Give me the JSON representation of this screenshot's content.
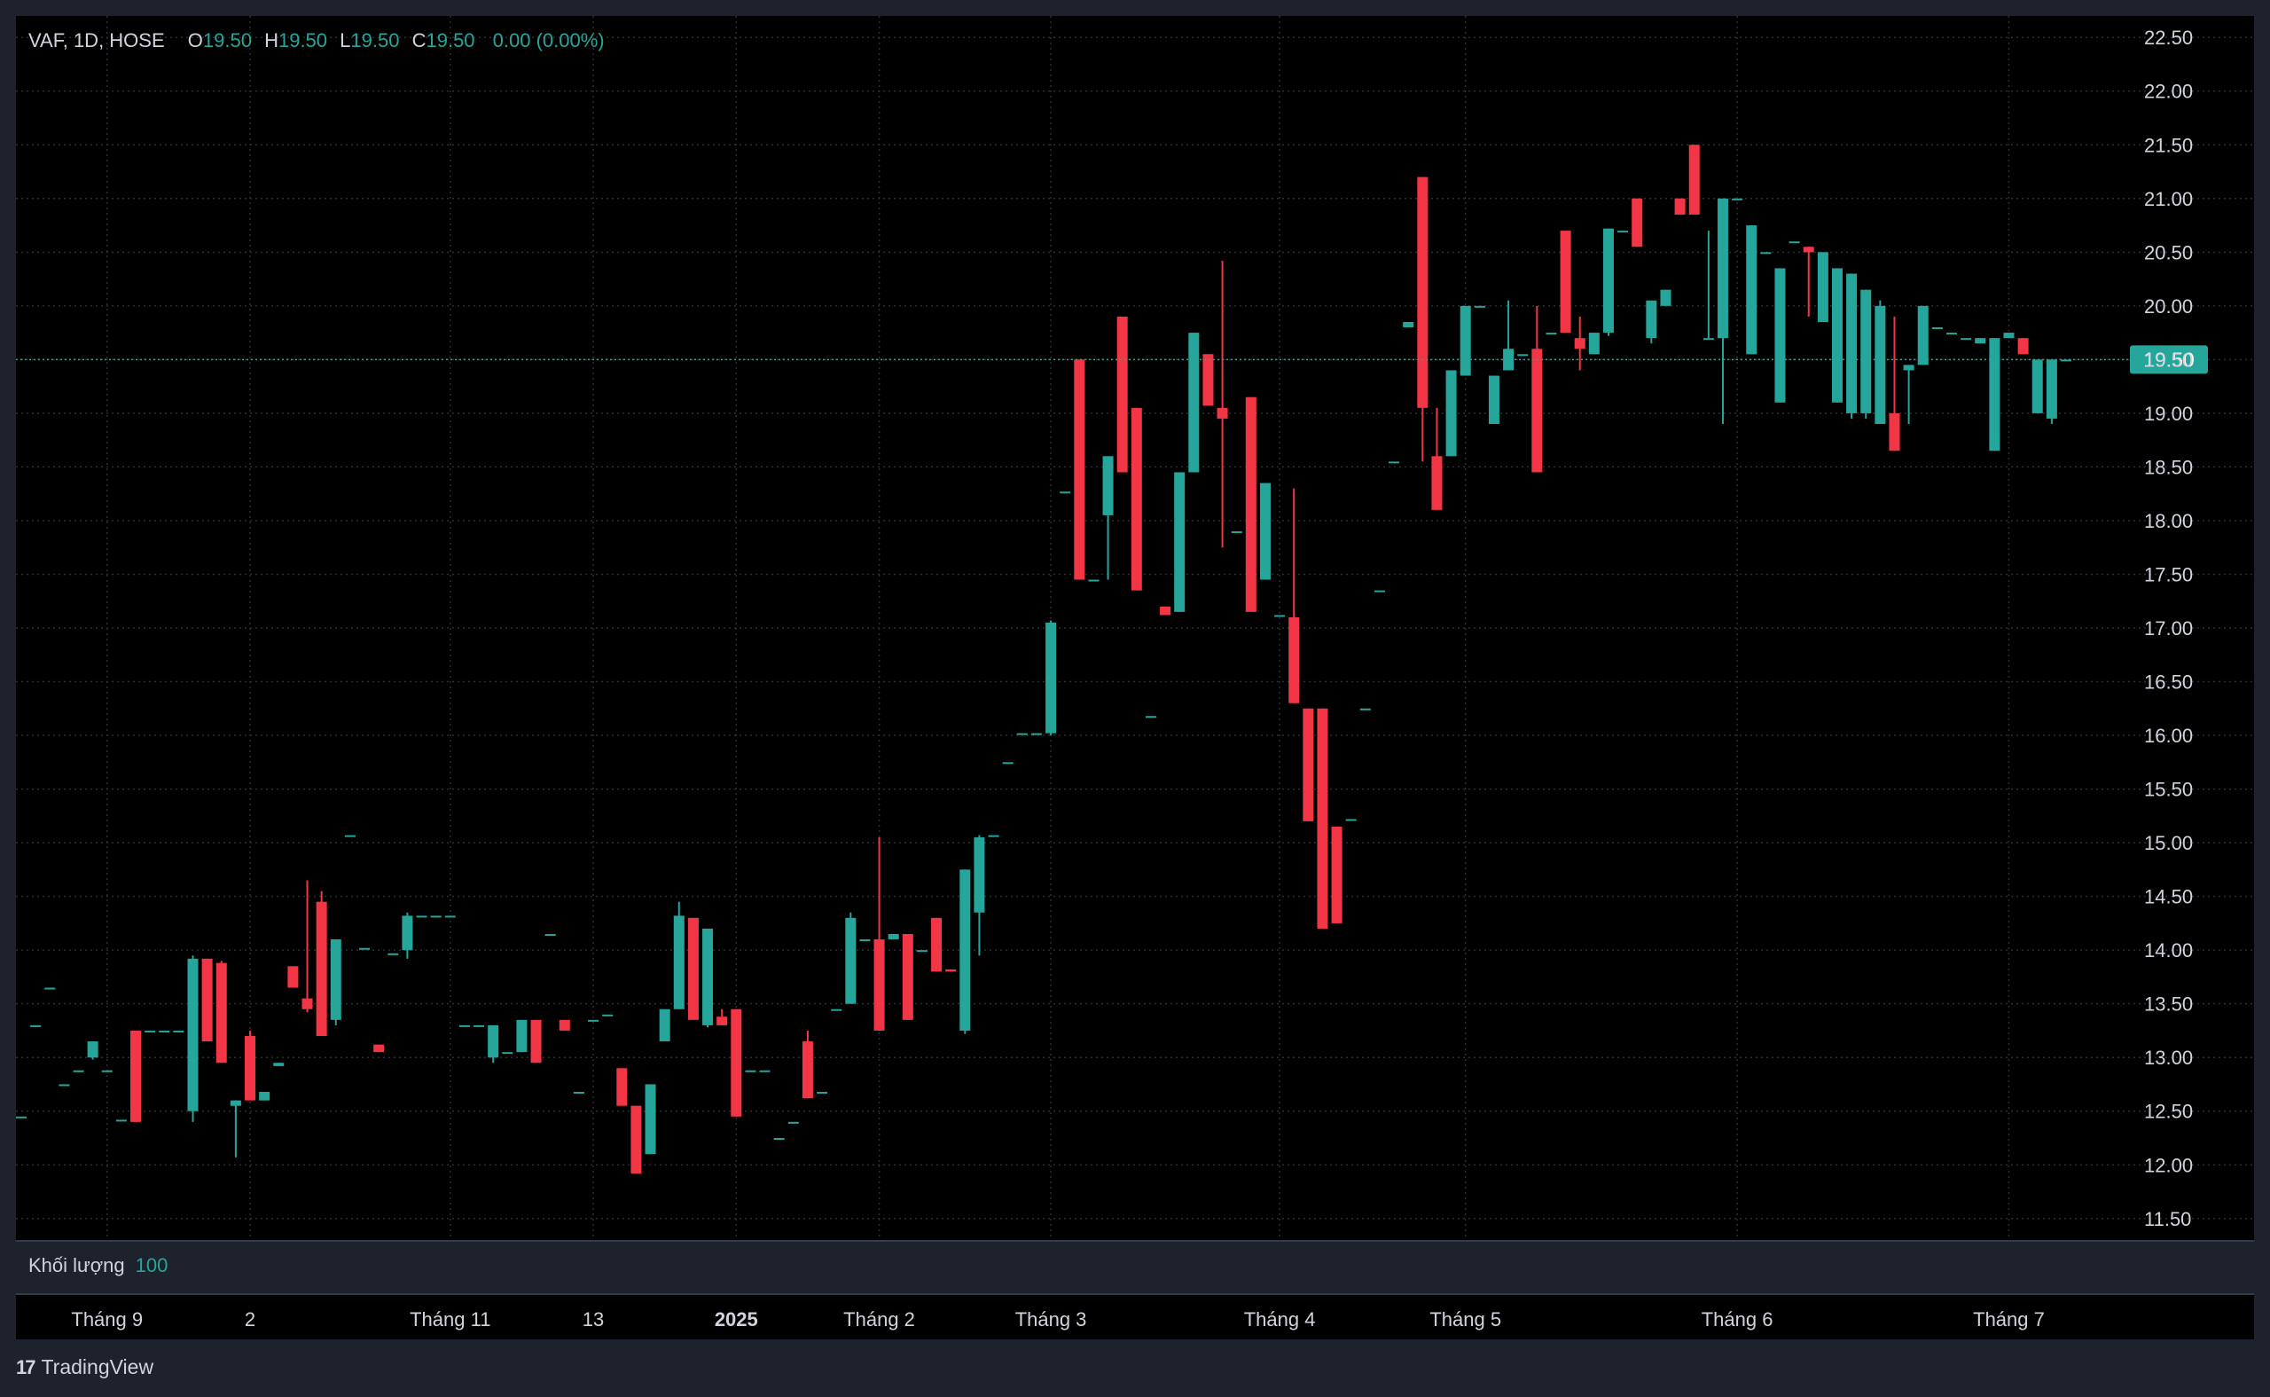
{
  "legend": {
    "symbol": "VAF, 1D, HOSE",
    "open_label": "O",
    "open": "19.50",
    "high_label": "H",
    "high": "19.50",
    "low_label": "L",
    "low": "19.50",
    "close_label": "C",
    "close": "19.50",
    "change": "0.00 (0.00%)"
  },
  "volume": {
    "label": "Khối lượng",
    "value": "100"
  },
  "brand": {
    "logo_icon": "tradingview-logo-icon",
    "name": "TradingView"
  },
  "colors": {
    "up": "#26a69a",
    "down": "#f23645",
    "background": "#000000",
    "frame": "#1e222d",
    "grid": "#2a2e39",
    "text": "#d1d4dc"
  },
  "chart_data": {
    "type": "candlestick",
    "grid": true,
    "y_axis_position": "right",
    "ylim": [
      11.3,
      22.7
    ],
    "y_ticks": [
      "22.50",
      "22.00",
      "21.50",
      "21.00",
      "20.50",
      "20.00",
      "19.50",
      "19.00",
      "18.50",
      "18.00",
      "17.50",
      "17.00",
      "16.50",
      "16.00",
      "15.50",
      "15.00",
      "14.50",
      "14.00",
      "13.50",
      "13.00",
      "12.50",
      "12.00",
      "11.50"
    ],
    "last_price_label": "19.50",
    "x_ticks": [
      {
        "label": "Tháng 9",
        "i": 6,
        "bold": false
      },
      {
        "label": "2",
        "i": 16,
        "bold": false
      },
      {
        "label": "Tháng 11",
        "i": 30,
        "bold": false
      },
      {
        "label": "13",
        "i": 40,
        "bold": false
      },
      {
        "label": "2025",
        "i": 50,
        "bold": true
      },
      {
        "label": "Tháng 2",
        "i": 60,
        "bold": false
      },
      {
        "label": "Tháng 3",
        "i": 72,
        "bold": false
      },
      {
        "label": "Tháng 4",
        "i": 88,
        "bold": false
      },
      {
        "label": "Tháng 5",
        "i": 101,
        "bold": false
      },
      {
        "label": "Tháng 6",
        "i": 120,
        "bold": false
      },
      {
        "label": "Tháng 7",
        "i": 139,
        "bold": false
      }
    ],
    "candles": [
      [
        12.45,
        12.45,
        12.45,
        12.45
      ],
      [
        13.3,
        13.3,
        13.3,
        13.3
      ],
      [
        13.65,
        13.65,
        13.65,
        13.65
      ],
      [
        12.75,
        12.75,
        12.75,
        12.75
      ],
      [
        12.88,
        12.88,
        12.88,
        12.88
      ],
      [
        13.0,
        13.15,
        12.98,
        13.15
      ],
      [
        12.88,
        12.88,
        12.88,
        12.88
      ],
      [
        12.42,
        12.42,
        12.42,
        12.42
      ],
      [
        13.25,
        13.25,
        12.4,
        12.4
      ],
      [
        13.25,
        13.25,
        13.25,
        13.25
      ],
      [
        13.25,
        13.25,
        13.25,
        13.25
      ],
      [
        13.25,
        13.25,
        13.25,
        13.25
      ],
      [
        12.5,
        13.95,
        12.4,
        13.92
      ],
      [
        13.92,
        13.92,
        13.15,
        13.15
      ],
      [
        13.88,
        13.9,
        12.95,
        12.95
      ],
      [
        12.55,
        12.6,
        12.07,
        12.6
      ],
      [
        13.2,
        13.25,
        12.6,
        12.6
      ],
      [
        12.6,
        12.68,
        12.6,
        12.68
      ],
      [
        12.92,
        12.95,
        12.92,
        12.95
      ],
      [
        13.85,
        13.85,
        13.65,
        13.65
      ],
      [
        13.55,
        14.65,
        13.42,
        13.45
      ],
      [
        14.45,
        14.55,
        13.2,
        13.2
      ],
      [
        13.35,
        14.1,
        13.3,
        14.1
      ],
      [
        15.07,
        15.07,
        15.07,
        15.07
      ],
      [
        14.02,
        14.02,
        14.02,
        14.02
      ],
      [
        13.12,
        13.12,
        13.05,
        13.05
      ],
      [
        13.97,
        13.97,
        13.97,
        13.97
      ],
      [
        14.0,
        14.35,
        13.92,
        14.32
      ],
      [
        14.32,
        14.32,
        14.32,
        14.32
      ],
      [
        14.32,
        14.32,
        14.32,
        14.32
      ],
      [
        14.32,
        14.32,
        14.32,
        14.32
      ],
      [
        13.3,
        13.3,
        13.3,
        13.3
      ],
      [
        13.3,
        13.3,
        13.3,
        13.3
      ],
      [
        13.0,
        13.3,
        12.95,
        13.3
      ],
      [
        13.05,
        13.05,
        13.05,
        13.05
      ],
      [
        13.05,
        13.35,
        13.05,
        13.35
      ],
      [
        13.35,
        13.35,
        12.95,
        12.95
      ],
      [
        14.15,
        14.15,
        14.15,
        14.15
      ],
      [
        13.35,
        13.35,
        13.25,
        13.25
      ],
      [
        12.68,
        12.68,
        12.68,
        12.68
      ],
      [
        13.35,
        13.35,
        13.35,
        13.35
      ],
      [
        13.4,
        13.4,
        13.4,
        13.4
      ],
      [
        12.9,
        12.9,
        12.55,
        12.55
      ],
      [
        12.55,
        12.55,
        11.92,
        11.92
      ],
      [
        12.1,
        12.75,
        12.1,
        12.75
      ],
      [
        13.15,
        13.45,
        13.15,
        13.45
      ],
      [
        13.45,
        14.45,
        13.45,
        14.32
      ],
      [
        14.3,
        14.3,
        13.35,
        13.35
      ],
      [
        13.3,
        14.2,
        13.28,
        14.2
      ],
      [
        13.38,
        13.45,
        13.3,
        13.3
      ],
      [
        13.45,
        13.45,
        12.45,
        12.45
      ],
      [
        12.88,
        12.88,
        12.88,
        12.88
      ],
      [
        12.88,
        12.88,
        12.88,
        12.88
      ],
      [
        12.25,
        12.25,
        12.25,
        12.25
      ],
      [
        12.4,
        12.4,
        12.4,
        12.4
      ],
      [
        13.15,
        13.25,
        12.62,
        12.62
      ],
      [
        12.68,
        12.68,
        12.68,
        12.68
      ],
      [
        13.45,
        13.45,
        13.45,
        13.45
      ],
      [
        13.5,
        14.35,
        13.5,
        14.3
      ],
      [
        14.1,
        14.1,
        14.1,
        14.1
      ],
      [
        14.1,
        15.05,
        13.25,
        13.25
      ],
      [
        14.1,
        14.15,
        14.1,
        14.15
      ],
      [
        14.15,
        14.15,
        13.35,
        13.35
      ],
      [
        14.0,
        14.0,
        14.0,
        14.0
      ],
      [
        14.3,
        14.3,
        13.8,
        13.8
      ],
      [
        13.82,
        13.82,
        13.8,
        13.8
      ],
      [
        13.25,
        14.75,
        13.22,
        14.75
      ],
      [
        14.35,
        15.07,
        13.95,
        15.05
      ],
      [
        15.07,
        15.07,
        15.07,
        15.07
      ],
      [
        15.75,
        15.75,
        15.75,
        15.75
      ],
      [
        16.02,
        16.02,
        16.02,
        16.02
      ],
      [
        16.02,
        16.02,
        16.02,
        16.02
      ],
      [
        16.02,
        17.07,
        16.0,
        17.05
      ],
      [
        18.27,
        18.27,
        18.27,
        18.27
      ],
      [
        19.5,
        19.5,
        17.45,
        17.45
      ],
      [
        17.45,
        17.45,
        17.45,
        17.45
      ],
      [
        18.05,
        18.6,
        17.45,
        18.6
      ],
      [
        19.9,
        19.9,
        18.45,
        18.45
      ],
      [
        19.05,
        19.05,
        17.35,
        17.35
      ],
      [
        16.18,
        16.18,
        16.18,
        16.18
      ],
      [
        17.2,
        17.2,
        17.12,
        17.12
      ],
      [
        17.15,
        18.45,
        17.15,
        18.45
      ],
      [
        18.45,
        19.75,
        18.45,
        19.75
      ],
      [
        19.55,
        19.55,
        19.07,
        19.07
      ],
      [
        19.05,
        20.42,
        17.75,
        18.95
      ],
      [
        17.9,
        17.9,
        17.9,
        17.9
      ],
      [
        19.15,
        19.15,
        17.15,
        17.15
      ],
      [
        17.45,
        18.35,
        17.45,
        18.35
      ],
      [
        17.12,
        17.12,
        17.12,
        17.12
      ],
      [
        17.1,
        18.3,
        16.3,
        16.3
      ],
      [
        16.25,
        16.25,
        15.2,
        15.2
      ],
      [
        16.25,
        16.25,
        14.2,
        14.2
      ],
      [
        15.15,
        15.15,
        14.25,
        14.25
      ],
      [
        15.22,
        15.22,
        15.22,
        15.22
      ],
      [
        16.25,
        16.25,
        16.25,
        16.25
      ],
      [
        17.35,
        17.35,
        17.35,
        17.35
      ],
      [
        18.55,
        18.55,
        18.55,
        18.55
      ],
      [
        19.8,
        19.85,
        19.8,
        19.85
      ],
      [
        21.2,
        21.2,
        18.55,
        19.05
      ],
      [
        18.6,
        19.05,
        18.1,
        18.1
      ],
      [
        18.6,
        19.4,
        18.6,
        19.4
      ],
      [
        19.35,
        20.0,
        19.35,
        20.0
      ],
      [
        20.0,
        20.0,
        20.0,
        20.0
      ],
      [
        18.9,
        19.35,
        18.9,
        19.35
      ],
      [
        19.4,
        20.05,
        19.4,
        19.6
      ],
      [
        19.55,
        19.55,
        19.55,
        19.55
      ],
      [
        19.6,
        20.0,
        18.45,
        18.45
      ],
      [
        19.75,
        19.75,
        19.75,
        19.75
      ],
      [
        20.7,
        20.7,
        19.75,
        19.75
      ],
      [
        19.7,
        19.9,
        19.4,
        19.6
      ],
      [
        19.55,
        19.75,
        19.55,
        19.75
      ],
      [
        19.75,
        20.72,
        19.72,
        20.72
      ],
      [
        20.7,
        20.7,
        20.7,
        20.7
      ],
      [
        21.0,
        21.0,
        20.55,
        20.55
      ],
      [
        19.7,
        20.05,
        19.65,
        20.05
      ],
      [
        20.0,
        20.15,
        20.0,
        20.15
      ],
      [
        21.0,
        21.0,
        20.85,
        20.85
      ],
      [
        21.5,
        21.5,
        20.85,
        20.85
      ],
      [
        19.7,
        20.7,
        19.7,
        19.7
      ],
      [
        19.7,
        21.0,
        18.9,
        21.0
      ],
      [
        21.0,
        21.0,
        21.0,
        21.0
      ],
      [
        19.55,
        20.75,
        19.55,
        20.75
      ],
      [
        20.5,
        20.5,
        20.5,
        20.5
      ],
      [
        19.1,
        20.35,
        19.1,
        20.35
      ],
      [
        20.6,
        20.6,
        20.6,
        20.6
      ],
      [
        20.55,
        20.55,
        19.9,
        20.5
      ],
      [
        19.85,
        20.5,
        19.85,
        20.5
      ],
      [
        19.1,
        20.35,
        19.1,
        20.35
      ],
      [
        19.0,
        20.3,
        18.95,
        20.3
      ],
      [
        19.0,
        20.15,
        18.95,
        20.15
      ],
      [
        18.9,
        20.05,
        18.9,
        20.0
      ],
      [
        19.0,
        19.9,
        18.65,
        18.65
      ],
      [
        19.4,
        19.45,
        18.9,
        19.45
      ],
      [
        19.45,
        20.0,
        19.45,
        20.0
      ],
      [
        19.8,
        19.8,
        19.8,
        19.8
      ],
      [
        19.75,
        19.75,
        19.75,
        19.75
      ],
      [
        19.7,
        19.7,
        19.7,
        19.7
      ],
      [
        19.65,
        19.7,
        19.65,
        19.7
      ],
      [
        18.65,
        19.7,
        18.65,
        19.7
      ],
      [
        19.7,
        19.75,
        19.7,
        19.75
      ],
      [
        19.7,
        19.7,
        19.55,
        19.55
      ],
      [
        19.0,
        19.5,
        19.0,
        19.5
      ],
      [
        18.95,
        19.5,
        18.9,
        19.5
      ],
      [
        19.5,
        19.5,
        19.5,
        19.5
      ]
    ]
  }
}
